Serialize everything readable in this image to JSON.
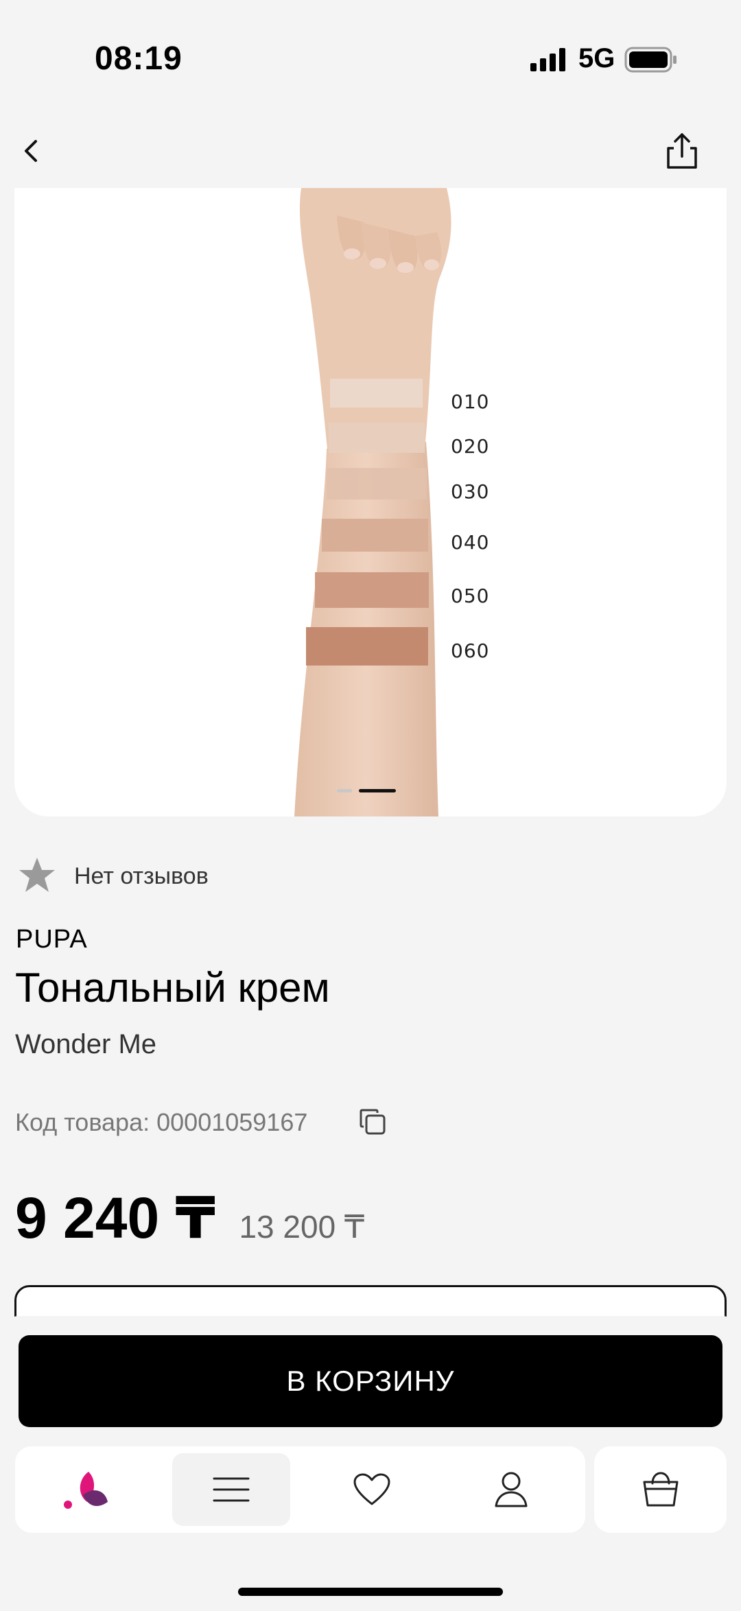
{
  "status_bar": {
    "time": "08:19",
    "network": "5G"
  },
  "gallery": {
    "shades": [
      "010",
      "020",
      "030",
      "040",
      "050",
      "060"
    ],
    "shade_colors": [
      "#ecd9cd",
      "#e8cfbe",
      "#e2c1ad",
      "#d9ae96",
      "#cf9c83",
      "#c38a70"
    ],
    "page_count": 2,
    "active_page": 2
  },
  "rating": {
    "text": "Нет отзывов"
  },
  "product": {
    "brand": "PUPA",
    "title": "Тональный крем",
    "subtitle": "Wonder Me",
    "sku_label": "Код товара:",
    "sku_value": "00001059167",
    "price": "9 240 ₸",
    "old_price": "13 200 ₸"
  },
  "actions": {
    "add_to_cart": "В КОРЗИНУ"
  },
  "tab_bar": {
    "items": [
      {
        "icon": "logo-icon",
        "active": false
      },
      {
        "icon": "menu-icon",
        "active": true
      },
      {
        "icon": "heart-icon",
        "active": false
      },
      {
        "icon": "profile-icon",
        "active": false
      },
      {
        "icon": "cart-icon",
        "active": false
      }
    ]
  },
  "colors": {
    "accent": "#e0157a",
    "button": "#000000",
    "background": "#f4f4f4"
  }
}
